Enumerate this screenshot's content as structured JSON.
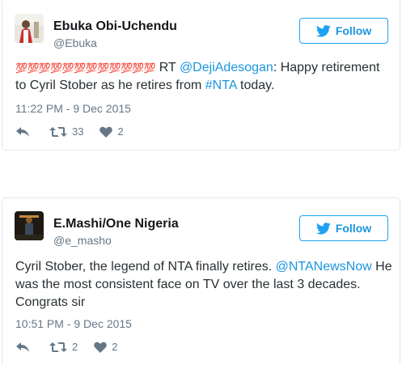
{
  "tweets": [
    {
      "name": "Ebuka Obi-Uchendu",
      "handle": "@Ebuka",
      "follow_label": "Follow",
      "emoji_text": "💯💯💯💯💯💯💯💯💯💯💯💯",
      "text_rt": " RT ",
      "mention": "@DejiAdesogan",
      "text_mid": ": Happy retirement to Cyril Stober as he retires from ",
      "hashtag": "#NTA",
      "text_end": " today.",
      "timestamp": "11:22 PM - 9 Dec 2015",
      "retweet_count": "33",
      "like_count": "2"
    },
    {
      "name": "E.Mashi/One Nigeria",
      "handle": "@e_masho",
      "follow_label": "Follow",
      "text_start": "Cyril Stober, the legend of NTA finally retires. ",
      "mention": "@NTANewsNow",
      "text_end": " He was the most consistent face on TV over the last 3 decades. Congrats sir",
      "timestamp": "10:51 PM - 9 Dec 2015",
      "retweet_count": "2",
      "like_count": "2"
    }
  ],
  "colors": {
    "brand_blue": "#1da1f2",
    "link_blue": "#1b95e0",
    "muted": "#657786"
  },
  "icons": [
    "twitter-bird-icon",
    "reply-icon",
    "retweet-icon",
    "heart-icon"
  ]
}
